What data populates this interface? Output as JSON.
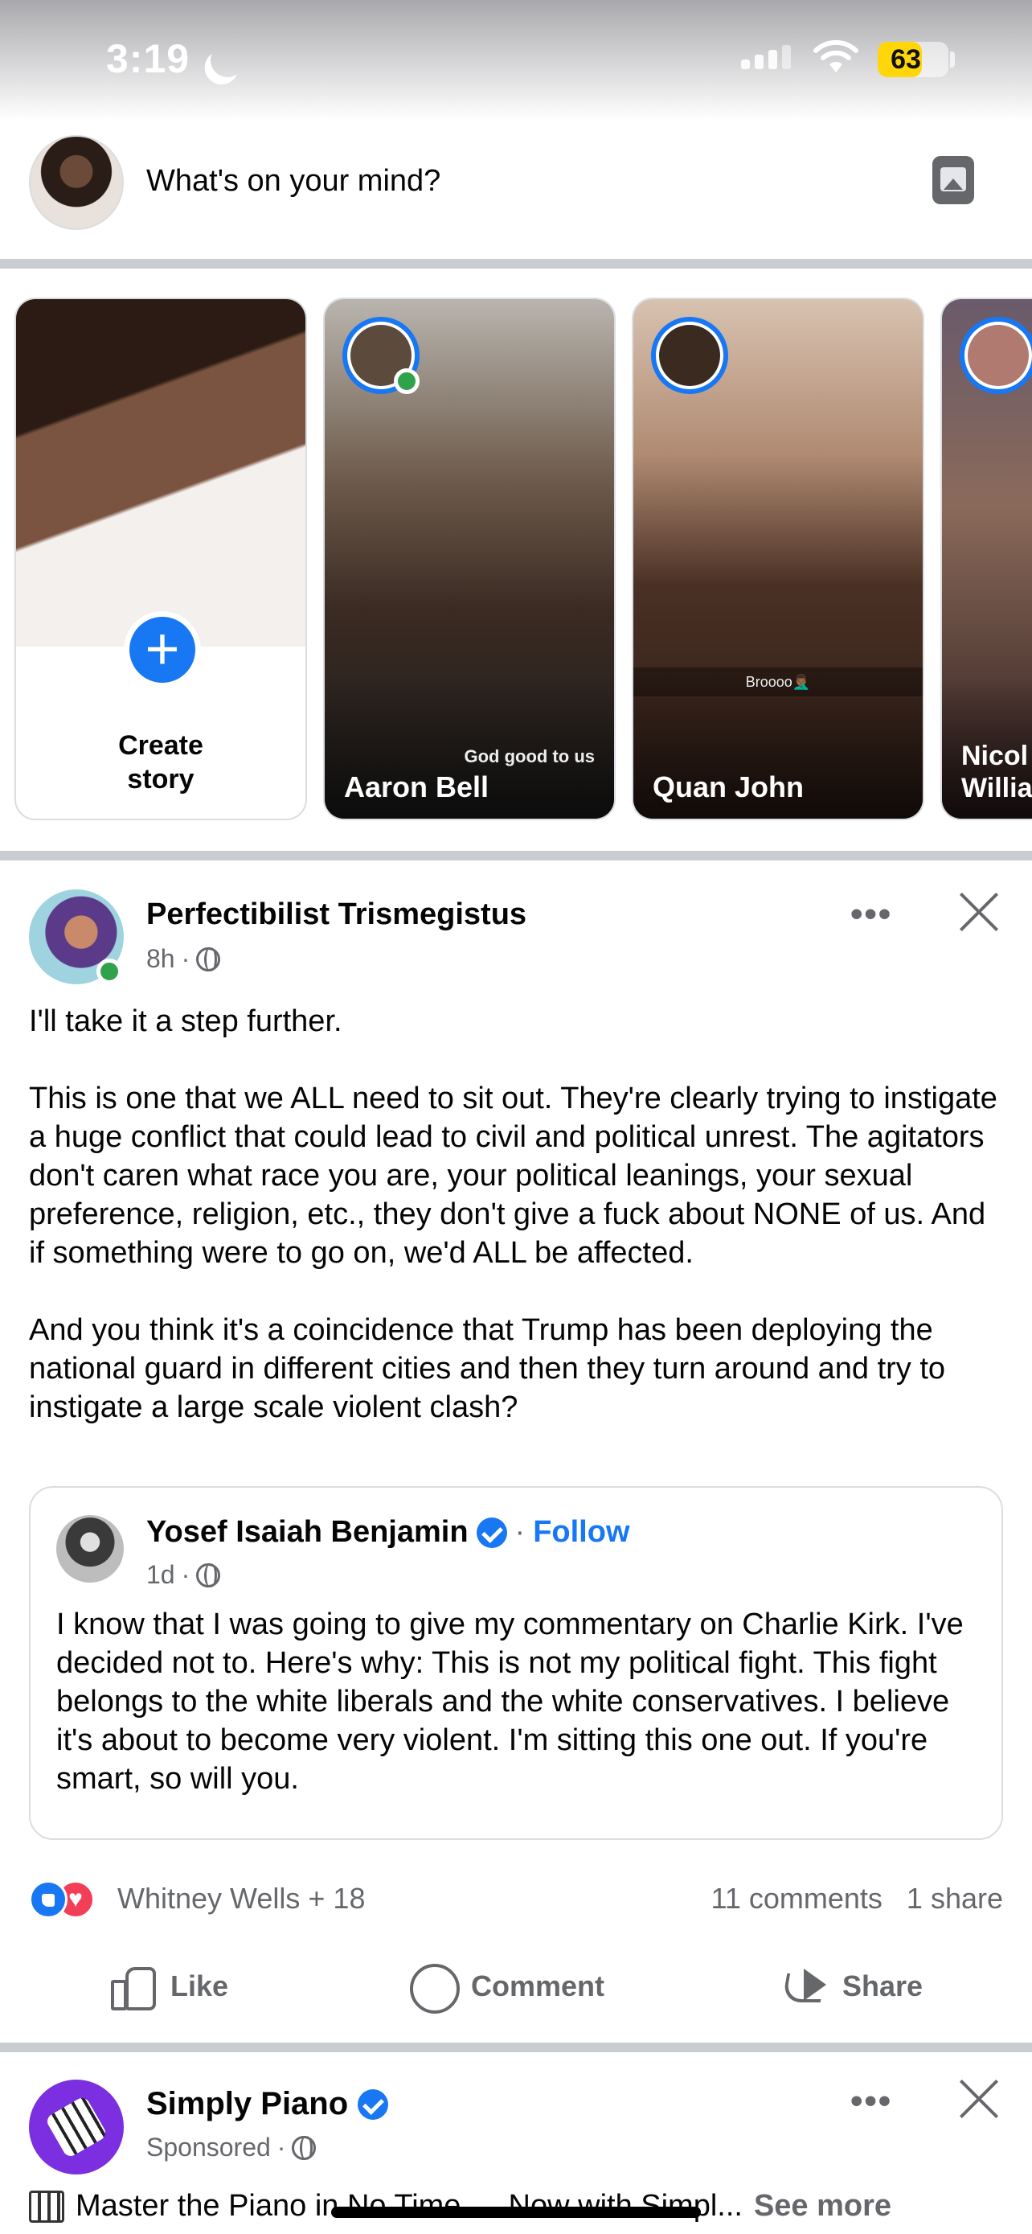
{
  "status_bar": {
    "time": "3:19",
    "battery": "63",
    "battery_percent": 63
  },
  "composer": {
    "placeholder": "What's on your mind?"
  },
  "stories": {
    "create": {
      "label": "Create story"
    },
    "items": [
      {
        "name": "Aaron Bell",
        "caption": "God good to us",
        "online": true
      },
      {
        "name": "Quan John",
        "caption": "Broooo🤦🏾‍♂️",
        "online": false
      },
      {
        "name": "Nicol Willia",
        "online": false
      }
    ]
  },
  "post": {
    "author": "Perfectibilist Trismegistus",
    "time": "8h",
    "sep": "·",
    "text": "I'll take it a step further.\n\nThis is one that we ALL need to sit out. They're clearly trying to instigate a huge conflict that could lead to civil and political unrest. The agitators don't caren what race you are, your political leanings, your sexual preference, religion, etc., they don't give a fuck about NONE of us. And if something were to go on, we'd ALL be affected.\n\nAnd you think it's a coincidence that Trump has been deploying the national guard in different cities and then they turn around and try to instigate a large scale violent clash?",
    "shared": {
      "author": "Yosef Isaiah Benjamin",
      "follow_sep": "·",
      "follow": "Follow",
      "time": "1d",
      "sep": "·",
      "text": "I know that I was going to give my commentary on Charlie Kirk. I've decided not to. Here's why: This is not my political fight. This fight belongs to the white liberals and the white conservatives. I believe it's about to become very violent. I'm sitting this one out. If you're smart, so will you."
    },
    "reactions": {
      "names": "Whitney Wells + 18",
      "comments": "11 comments",
      "shares": "1 share"
    },
    "actions": {
      "like": "Like",
      "comment": "Comment",
      "share": "Share"
    },
    "more": "•••"
  },
  "sponsored": {
    "name": "Simply Piano",
    "label": "Sponsored",
    "sep": "·",
    "text": "Master the Piano in No Time — Now with Simpl...",
    "see_more": "See more"
  },
  "colors": {
    "accent": "#1877f2",
    "online": "#31a24c",
    "love": "#f33e58",
    "battery": "#ffd60a"
  }
}
